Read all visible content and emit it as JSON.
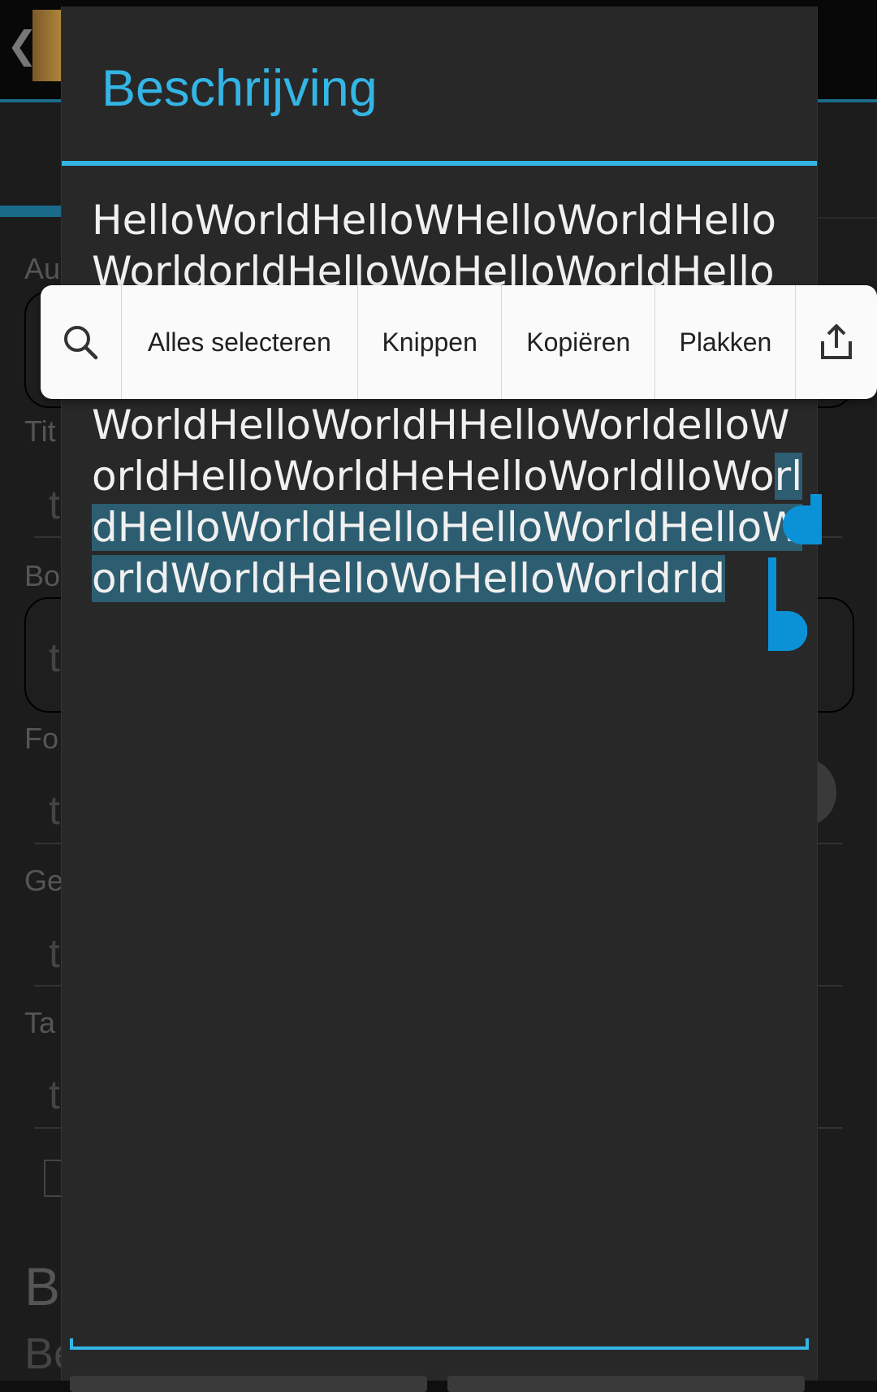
{
  "dialog": {
    "title": "Beschrijving",
    "text_lines": [
      "HelloWorldHelloWHelloWorldHello",
      "WorldorldHelloWoHelloWorldHello",
      "",
      "",
      "WorldHelloWorldHHelloWorldelloW"
    ],
    "line6_unselected": "orldHelloWorldHeHelloWorldlloWo",
    "line6_selected": "rl",
    "line7_selected": "dHelloWorldHelloHelloWorldHelloW",
    "line8_selected": "orldWorldHelloWoHelloWorldrld"
  },
  "toolbar": {
    "search_icon": "search-icon",
    "select_all": "Alles selecteren",
    "cut": "Knippen",
    "copy": "Kopiëren",
    "paste": "Plakken",
    "share_icon": "share-icon"
  },
  "background": {
    "back_glyph": "❮",
    "labels": [
      "Au",
      "Tit",
      "Bo",
      "Fo",
      "Ge",
      "Ta"
    ],
    "placeholder_glyph": "t",
    "section_big": "Be",
    "section_big2": "Be"
  },
  "colors": {
    "accent": "#33b5e5",
    "selection": "#2d5d70",
    "handle": "#0b92d6",
    "dialog_bg": "#282828",
    "toolbar_bg": "#fafafa"
  }
}
